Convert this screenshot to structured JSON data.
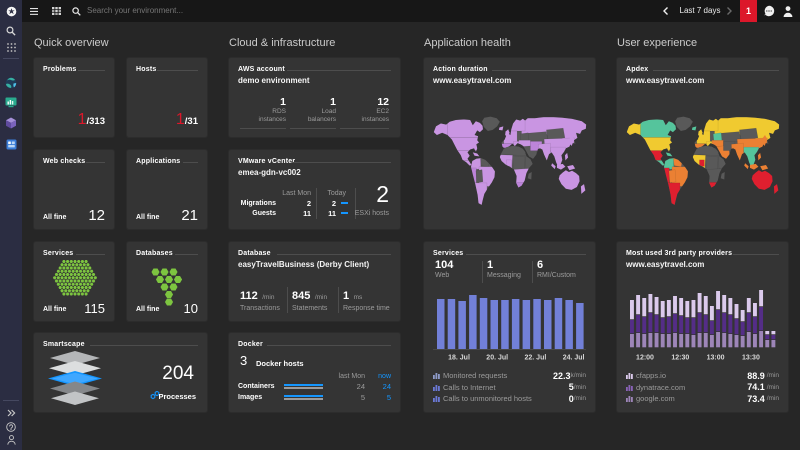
{
  "topbar": {
    "search_placeholder": "Search your environment...",
    "timeframe": "Last 7 days",
    "problems_badge": "1",
    "icons": [
      "dynatrace-logo",
      "hamburger-menu",
      "apps-grid",
      "search",
      "chevron-left",
      "chevron-right",
      "feedback-chat",
      "user"
    ]
  },
  "sidebar": {
    "icons": [
      "search",
      "apps-grid",
      "globe",
      "deployment",
      "smartscape-cube",
      "hub-grid",
      "collapse",
      "help",
      "user-profile"
    ]
  },
  "columns": [
    {
      "title": "Quick overview"
    },
    {
      "title": "Cloud & infrastructure"
    },
    {
      "title": "Application health"
    },
    {
      "title": "User experience"
    }
  ],
  "tiles": {
    "problems": {
      "title": "Problems",
      "value": "1",
      "total": "/313"
    },
    "hosts": {
      "title": "Hosts",
      "value": "1",
      "total": "/31"
    },
    "web_checks": {
      "title": "Web checks",
      "status": "All fine",
      "value": "12"
    },
    "applications": {
      "title": "Applications",
      "status": "All fine",
      "value": "21"
    },
    "services_small": {
      "title": "Services",
      "status": "All fine",
      "value": "115"
    },
    "databases": {
      "title": "Databases",
      "status": "All fine",
      "value": "10"
    },
    "smartscape": {
      "title": "Smartscape",
      "value": "204",
      "label": "Processes"
    },
    "aws": {
      "title": "AWS account",
      "subtitle": "demo environment",
      "stats": [
        {
          "value": "1",
          "label1": "RDS",
          "label2": "instances"
        },
        {
          "value": "1",
          "label1": "Load",
          "label2": "balancers"
        },
        {
          "value": "12",
          "label1": "EC2",
          "label2": "instances"
        }
      ]
    },
    "vmware": {
      "title": "VMware vCenter",
      "subtitle": "emea-gdn-vc002",
      "col1": "Last Mon",
      "col2": "Today",
      "rows": [
        {
          "label": "Migrations",
          "v1": "2",
          "v2": "2"
        },
        {
          "label": "Guests",
          "v1": "11",
          "v2": "11"
        }
      ],
      "big_value": "2",
      "big_label": "ESXi hosts"
    },
    "database": {
      "title": "Database",
      "subtitle": "easyTravelBusiness (Derby Client)",
      "stats": [
        {
          "value": "112",
          "unit": "/min",
          "label": "Transactions"
        },
        {
          "value": "845",
          "unit": "/min",
          "label": "Statements"
        },
        {
          "value": "1",
          "unit": "ms",
          "label": "Response time"
        }
      ]
    },
    "docker": {
      "title": "Docker",
      "count": "3",
      "count_label": "Docker hosts",
      "col1": "last Mon",
      "col2": "now",
      "rows": [
        {
          "label": "Containers",
          "v1": "24",
          "v2": "24"
        },
        {
          "label": "Images",
          "v1": "5",
          "v2": "5"
        }
      ]
    },
    "action_duration": {
      "title": "Action duration",
      "subtitle": "www.easytravel.com"
    },
    "services": {
      "title": "Services",
      "stats": [
        {
          "value": "104",
          "label": "Web"
        },
        {
          "value": "1",
          "label": "Messaging"
        },
        {
          "value": "6",
          "label": "RMI/Custom"
        }
      ],
      "legend": [
        {
          "label": "Monitored requests",
          "value": "22.3",
          "unit": "k/min"
        },
        {
          "label": "Calls to Internet",
          "value": "5",
          "unit": "/min"
        },
        {
          "label": "Calls to unmonitored hosts",
          "value": "0",
          "unit": "/min"
        }
      ]
    },
    "apdex": {
      "title": "Apdex",
      "subtitle": "www.easytravel.com"
    },
    "third_party": {
      "title": "Most used 3rd party providers",
      "subtitle": "www.easytravel.com",
      "legend": [
        {
          "label": "cfapps.io",
          "value": "88.9",
          "unit": "/min"
        },
        {
          "label": "dynatrace.com",
          "value": "74.1",
          "unit": "/min"
        },
        {
          "label": "google.com",
          "value": "73.4",
          "unit": "/min"
        }
      ]
    }
  },
  "colors": {
    "red": "#dc172a",
    "blue": "#1496ff",
    "green": "#7dc540",
    "bar_blue": "#7280d8",
    "purple_light": "#dbcaec",
    "purple_dark": "#542d87",
    "purple_mid": "#9d85b8",
    "map_purple": "#c995e2",
    "map_purple2": "#b379d6",
    "map_gray": "#595959",
    "map_yellow": "#f0ca30",
    "map_teal": "#55c49c",
    "map_orange": "#eb8033",
    "map_red": "#df1f2f"
  },
  "chart_data": [
    {
      "name": "services_requests",
      "type": "bar",
      "x": [
        "18. Jul",
        "20. Jul",
        "22. Jul",
        "24. Jul"
      ],
      "values": [
        50,
        50,
        48,
        54,
        51,
        49,
        49,
        50,
        49,
        50,
        49,
        51,
        49,
        46
      ],
      "color": "#7280d8"
    },
    {
      "name": "third_party_providers",
      "type": "bar",
      "stacked": true,
      "x": [
        "12:00",
        "12:30",
        "13:00",
        "13:30"
      ],
      "series": [
        {
          "name": "bottom",
          "color": "#9d85b8",
          "values": [
            14,
            15,
            14,
            15,
            15,
            14,
            14,
            15,
            14,
            14,
            13,
            15,
            15,
            13,
            16,
            15,
            14,
            13,
            12,
            16,
            14,
            17,
            8,
            8
          ]
        },
        {
          "name": "middle",
          "color": "#542d87",
          "values": [
            14,
            18,
            17,
            20,
            18,
            16,
            17,
            19,
            18,
            16,
            17,
            20,
            18,
            14,
            22,
            20,
            19,
            16,
            14,
            19,
            17,
            24,
            5,
            5
          ]
        },
        {
          "name": "top",
          "color": "#dbcaec",
          "values": [
            20,
            20,
            19,
            19,
            18,
            17,
            17,
            18,
            18,
            17,
            18,
            20,
            19,
            15,
            19,
            18,
            17,
            15,
            12,
            15,
            14,
            17,
            4,
            4
          ]
        }
      ]
    },
    {
      "name": "docker_bars",
      "type": "bar",
      "rows": [
        {
          "now": 24,
          "lastmon": 24
        },
        {
          "now": 5,
          "lastmon": 5
        }
      ],
      "colors": {
        "now": "#1496ff",
        "lastmon": "#9b9b9b"
      }
    },
    {
      "name": "action_duration_map",
      "type": "choropleth",
      "regions": {
        "greenland": "#595959",
        "alaska": "#c995e2",
        "canada": "#c995e2",
        "usa": "#c995e2",
        "mexico": "#c995e2",
        "camerica": "#c995e2",
        "colombia": "#c995e2",
        "venezuela": "#595959",
        "brazil": "#c995e2",
        "peru": "#bd84da",
        "argentina": "#c995e2",
        "iceland": "#c995e2",
        "uk": "#c995e2",
        "scandinavia": "#c995e2",
        "west_europe": "#c995e2",
        "iberia": "#bd84da",
        "italy": "#c995e2",
        "east_europe": "#595959",
        "russia": "#c995e2",
        "kazakh": "#595959",
        "mongolia": "#595959",
        "turkey": "#c995e2",
        "middle_east": "#595959",
        "iran": "#bd84da",
        "north_africa": "#595959",
        "west_africa": "#c995e2",
        "central_africa": "#595959",
        "east_africa": "#595959",
        "south_africa": "#c995e2",
        "za": "#bd84da",
        "madagascar": "#595959",
        "india": "#c995e2",
        "china": "#c995e2",
        "se_asia": "#c995e2",
        "indonesia": "#c995e2",
        "japan": "#c995e2",
        "australia": "#c995e2",
        "nz": "#c995e2",
        "bolivia": "#595959",
        "nigeria": "#c995e2"
      }
    },
    {
      "name": "apdex_map",
      "type": "choropleth",
      "regions": {
        "greenland": "#595959",
        "alaska": "#f0ca30",
        "canada": "#55c49c",
        "usa": "#f0ca30",
        "mexico": "#df1f2f",
        "camerica": "#55c49c",
        "colombia": "#55c49c",
        "venezuela": "#eb8033",
        "brazil": "#eb8033",
        "peru": "#df1f2f",
        "argentina": "#df1f2f",
        "iceland": "#55c49c",
        "uk": "#f0ca30",
        "scandinavia": "#f0ca30",
        "west_europe": "#f0ca30",
        "iberia": "#eb8033",
        "italy": "#f0ca30",
        "east_europe": "#55c49c",
        "russia": "#f0ca30",
        "kazakh": "#595959",
        "mongolia": "#595959",
        "turkey": "#eb8033",
        "middle_east": "#eb8033",
        "iran": "#595959",
        "north_africa": "#595959",
        "west_africa": "#f0ca30",
        "central_africa": "#595959",
        "east_africa": "#595959",
        "south_africa": "#595959",
        "za": "#df1f2f",
        "madagascar": "#595959",
        "india": "#eb8033",
        "china": "#eb8033",
        "se_asia": "#55c49c",
        "indonesia": "#eb8033",
        "japan": "#eb8033",
        "australia": "#df1f2f",
        "nz": "#df1f2f",
        "bolivia": "#eb8033",
        "nigeria": "#df1f2f"
      }
    }
  ]
}
